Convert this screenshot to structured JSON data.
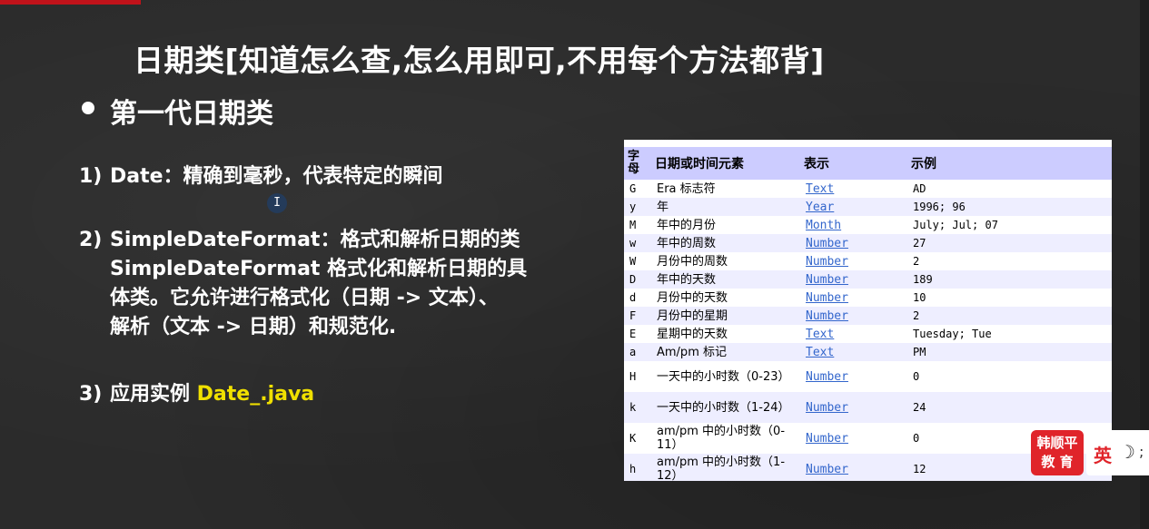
{
  "slide": {
    "title": "日期类[知道怎么查,怎么用即可,不用每个方法都背]",
    "section_heading": "第一代日期类",
    "items": [
      {
        "num": "1)",
        "lines": [
          "Date：精确到毫秒，代表特定的瞬间"
        ]
      },
      {
        "num": "2)",
        "lines": [
          "SimpleDateFormat：格式和解析日期的类",
          "SimpleDateFormat 格式化和解析日期的具",
          "体类。它允许进行格式化（日期 -> 文本）、",
          "解析（文本 -> 日期）和规范化."
        ]
      },
      {
        "num": "3)",
        "prefix": "应用实例 ",
        "highlight": "Date_.java"
      }
    ],
    "cursor_glyph": "I"
  },
  "format_table": {
    "headers": [
      "字母",
      "日期或时间元素",
      "表示",
      "示例"
    ],
    "rows": [
      {
        "letter": "G",
        "element": "Era 标志符",
        "presentation": "Text",
        "example": "AD"
      },
      {
        "letter": "y",
        "element": "年",
        "presentation": "Year",
        "example": "1996; 96"
      },
      {
        "letter": "M",
        "element": "年中的月份",
        "presentation": "Month",
        "example": "July; Jul; 07"
      },
      {
        "letter": "w",
        "element": "年中的周数",
        "presentation": "Number",
        "example": "27"
      },
      {
        "letter": "W",
        "element": "月份中的周数",
        "presentation": "Number",
        "example": "2"
      },
      {
        "letter": "D",
        "element": "年中的天数",
        "presentation": "Number",
        "example": "189"
      },
      {
        "letter": "d",
        "element": "月份中的天数",
        "presentation": "Number",
        "example": "10"
      },
      {
        "letter": "F",
        "element": "月份中的星期",
        "presentation": "Number",
        "example": "2"
      },
      {
        "letter": "E",
        "element": "星期中的天数",
        "presentation": "Text",
        "example": "Tuesday; Tue"
      },
      {
        "letter": "a",
        "element": "Am/pm 标记",
        "presentation": "Text",
        "example": "PM"
      },
      {
        "letter": "H",
        "element": "一天中的小时数（0-23）",
        "presentation": "Number",
        "example": "0"
      },
      {
        "letter": "k",
        "element": "一天中的小时数（1-24）",
        "presentation": "Number",
        "example": "24"
      },
      {
        "letter": "K",
        "element": "am/pm 中的小时数（0-11）",
        "presentation": "Number",
        "example": "0"
      },
      {
        "letter": "h",
        "element": "am/pm 中的小时数（1-12）",
        "presentation": "Number",
        "example": "12"
      }
    ]
  },
  "logo": {
    "line1": "韩顺平",
    "line2": "教 育"
  },
  "toolbar": {
    "lang_label": "英",
    "moon_icon": "moon-icon",
    "semicolon": ";"
  },
  "colors": {
    "accent_red": "#e0242a",
    "highlight_yellow": "#f0e000",
    "table_header": "#ccccff",
    "link": "#3366cc"
  }
}
